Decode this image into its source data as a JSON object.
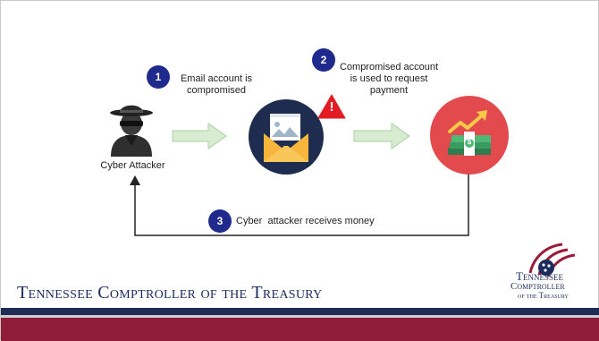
{
  "diagram": {
    "steps": [
      {
        "number": "1",
        "text_lines": [
          "Email account is",
          "compromised"
        ]
      },
      {
        "number": "2",
        "text_lines": [
          "Compromised account",
          "is used to request",
          "payment"
        ]
      },
      {
        "number": "3",
        "text_lines": [
          "Cyber  attacker receives money"
        ]
      }
    ],
    "actor_label": "Cyber Attacker",
    "alert_symbol": "!",
    "money_symbol": "$"
  },
  "footer": {
    "title": "Tennessee Comptroller of the Treasury"
  },
  "logo": {
    "line1": "Tennessee",
    "line2": "Comptroller",
    "line3": "of the Treasury"
  },
  "colors": {
    "badge": "#1f2a8c",
    "arrow": "#d8ecd2",
    "envelope_circle": "#1e2d4f",
    "money_circle": "#e24a4e",
    "alert": "#e31b23",
    "footer_navy": "#1f2d56",
    "footer_red": "#8f1d3a"
  },
  "icons": [
    "hacker-icon",
    "email-icon",
    "warning-icon",
    "money-growth-icon",
    "state-seal-logo"
  ]
}
